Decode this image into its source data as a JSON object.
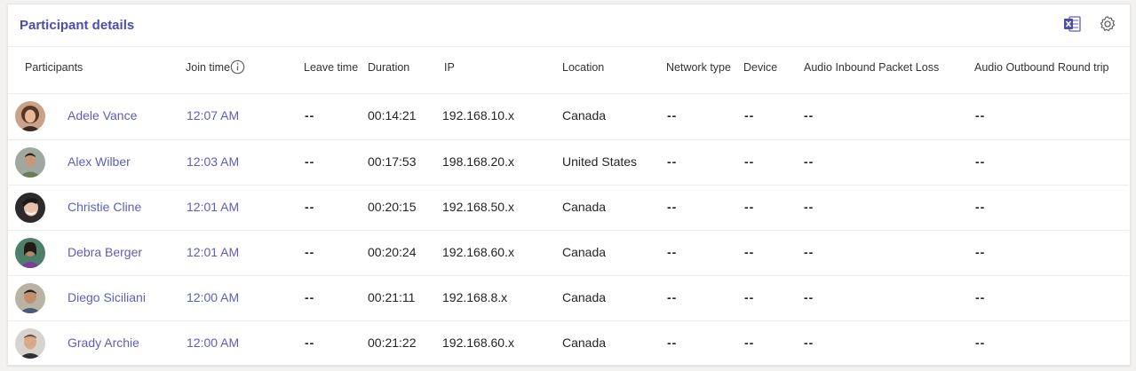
{
  "panel": {
    "title": "Participant details",
    "export_icon": "excel-icon",
    "settings_icon": "gear-icon"
  },
  "columns": {
    "participants": "Participants",
    "join_time": "Join time",
    "leave_time": "Leave time",
    "duration": "Duration",
    "ip": "IP",
    "location": "Location",
    "network_type": "Network type",
    "device": "Device",
    "audio_inbound": "Audio Inbound Packet Loss",
    "audio_outbound": "Audio Outbound Round trip"
  },
  "rows": [
    {
      "name": "Adele Vance",
      "join": "12:07 AM",
      "leave": "--",
      "duration": "00:14:21",
      "ip": "192.168.10.x",
      "location": "Canada",
      "network": "--",
      "device": "--",
      "inbound": "--",
      "outbound": "--"
    },
    {
      "name": "Alex Wilber",
      "join": "12:03 AM",
      "leave": "--",
      "duration": "00:17:53",
      "ip": "198.168.20.x",
      "location": "United States",
      "network": "--",
      "device": "--",
      "inbound": "--",
      "outbound": "--"
    },
    {
      "name": "Christie Cline",
      "join": "12:01 AM",
      "leave": "--",
      "duration": "00:20:15",
      "ip": "192.168.50.x",
      "location": "Canada",
      "network": "--",
      "device": "--",
      "inbound": "--",
      "outbound": "--"
    },
    {
      "name": "Debra Berger",
      "join": "12:01 AM",
      "leave": "--",
      "duration": "00:20:24",
      "ip": "192.168.60.x",
      "location": "Canada",
      "network": "--",
      "device": "--",
      "inbound": "--",
      "outbound": "--"
    },
    {
      "name": "Diego Siciliani",
      "join": "12:00 AM",
      "leave": "--",
      "duration": "00:21:11",
      "ip": "192.168.8.x",
      "location": "Canada",
      "network": "--",
      "device": "--",
      "inbound": "--",
      "outbound": "--"
    },
    {
      "name": "Grady Archie",
      "join": "12:00 AM",
      "leave": "--",
      "duration": "00:21:22",
      "ip": "192.168.60.x",
      "location": "Canada",
      "network": "--",
      "device": "--",
      "inbound": "--",
      "outbound": "--"
    }
  ],
  "colors": {
    "accent": "#4b4dad",
    "link": "#5c5fb6",
    "excel_green": "#217346"
  }
}
